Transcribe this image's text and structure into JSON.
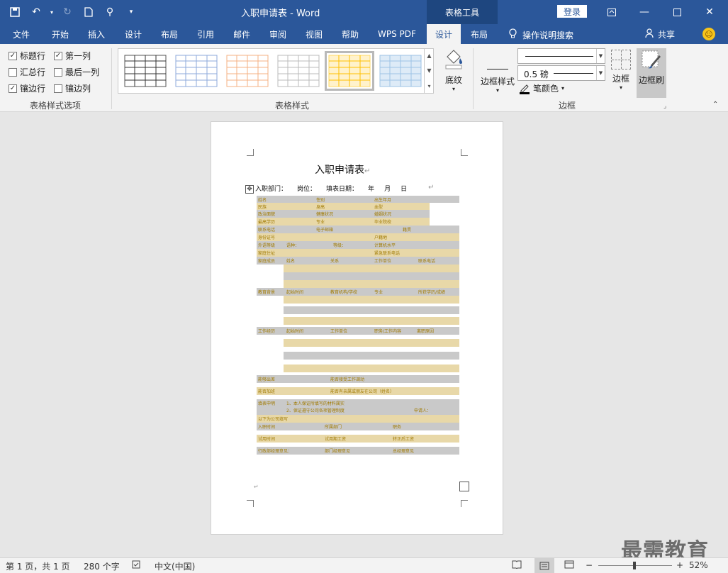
{
  "window": {
    "title": "入职申请表  -  Word",
    "context_tools": "表格工具",
    "login": "登录"
  },
  "tabs": [
    {
      "label": "文件"
    },
    {
      "label": "开始"
    },
    {
      "label": "插入"
    },
    {
      "label": "设计"
    },
    {
      "label": "布局"
    },
    {
      "label": "引用"
    },
    {
      "label": "邮件"
    },
    {
      "label": "审阅"
    },
    {
      "label": "视图"
    },
    {
      "label": "帮助"
    },
    {
      "label": "WPS PDF"
    },
    {
      "label": "设计"
    },
    {
      "label": "布局"
    }
  ],
  "tellme": "操作说明搜索",
  "share": "共享",
  "ribbon": {
    "options": {
      "header_row": "标题行",
      "first_column": "第一列",
      "total_row": "汇总行",
      "last_column": "最后一列",
      "banded_rows": "镶边行",
      "banded_columns": "镶边列",
      "group_label": "表格样式选项"
    },
    "styles_label": "表格样式",
    "shading": "底纹",
    "border_styles": "边框样式",
    "weight": "0.5 磅",
    "pen_color": "笔颜色",
    "borders": "边框",
    "border_painter": "边框刷",
    "borders_group": "边框"
  },
  "document": {
    "title": "入职申请表",
    "info_line": [
      "入职部门：",
      "岗位：",
      "填表日期：",
      "年",
      "月",
      "日"
    ],
    "rows": [
      [
        "姓名",
        "性别",
        "出生年月"
      ],
      [
        "民族",
        "身高",
        "血型"
      ],
      [
        "政治面貌",
        "健康状况",
        "婚姻状况"
      ],
      [
        "最高学历",
        "专业",
        "毕业院校"
      ],
      [
        "联系电话",
        "电子邮箱",
        "籍贯"
      ],
      [
        "身份证号",
        "户籍地"
      ],
      [
        "外语等级",
        "语种：",
        "等级：",
        "计算机水平"
      ],
      [
        "家庭住址",
        "紧急联系电话"
      ],
      [
        "家庭成员",
        "姓名",
        "关系",
        "工作单位",
        "联系电话"
      ],
      [
        "教育背景",
        "起始时间",
        "教育机构/学校",
        "专业",
        "所获学历/成绩"
      ],
      [
        "工作经历",
        "起始时间",
        "工作单位",
        "职务/工作内容",
        "离职原因"
      ],
      [
        "能够出差",
        "能否接受工作调动"
      ],
      [
        "能否加班",
        "能否有亲属或朋友在公司（姓名）"
      ],
      [
        "填表申明",
        "1、本人保证所填写的材料属实",
        "2、保证遵守公司各项管理制度",
        "申请人："
      ],
      [
        "以下为公司填写"
      ],
      [
        "入职时间",
        "所属部门",
        "职务"
      ],
      [
        "试用时间",
        "试用期工资",
        "转正后工资"
      ],
      [
        "行政部经理意见：",
        "部门经理意见",
        "总经理意见"
      ]
    ]
  },
  "status": {
    "page": "第 1 页，共 1 页",
    "words": "280 个字",
    "language": "中文(中国)",
    "zoom": "52%"
  },
  "watermark": "最需教育"
}
